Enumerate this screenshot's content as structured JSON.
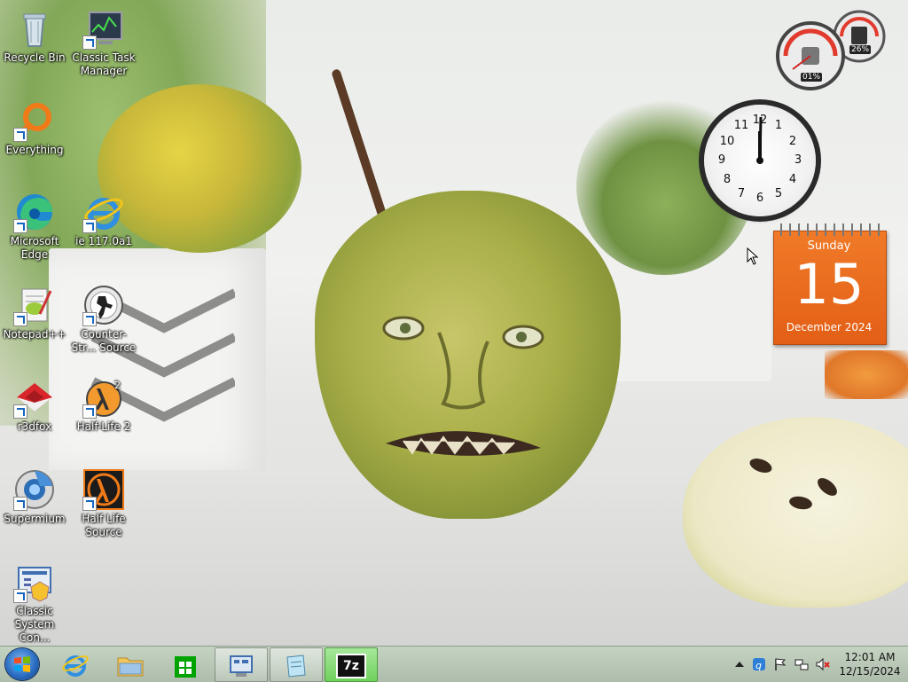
{
  "desktop": {
    "icons": [
      {
        "label": "Recycle Bin",
        "icon": "recycle-bin-icon"
      },
      {
        "label": "Classic Task Manager",
        "icon": "task-manager-icon"
      },
      {
        "label": "Everything",
        "icon": "everything-search-icon"
      },
      {
        "label": "Microsoft Edge",
        "icon": "edge-icon"
      },
      {
        "label": "ie 117.0a1",
        "icon": "internet-explorer-icon"
      },
      {
        "label": "Notepad++",
        "icon": "notepadpp-icon"
      },
      {
        "label": "Counter-Strike: Source",
        "icon": "counter-strike-icon"
      },
      {
        "label": "r3dfox",
        "icon": "r3dfox-icon"
      },
      {
        "label": "Half-Life 2",
        "icon": "half-life-2-icon"
      },
      {
        "label": "Supermium",
        "icon": "supermium-icon"
      },
      {
        "label": "Half Life Source",
        "icon": "half-life-source-icon"
      },
      {
        "label": "Classic System Control",
        "icon": "control-panel-icon"
      }
    ],
    "display_labels": {
      "recycle": "Recycle Bin",
      "taskmgr": "Classic Task Manager",
      "everything": "Everything",
      "edge": "Microsoft Edge",
      "ie": "ie 117.0a1",
      "notepad": "Notepad++",
      "cs": "Counter-Str... Source",
      "r3dfox": "r3dfox",
      "hl2": "Half-Life 2",
      "supermium": "Supermium",
      "hls": "Half Life Source",
      "classic_sys": "Classic System Con..."
    }
  },
  "gadgets": {
    "cpu_meter": {
      "cpu": "01%",
      "memory": "26%"
    },
    "clock": {
      "numbers": [
        "12",
        "1",
        "2",
        "3",
        "4",
        "5",
        "6",
        "7",
        "8",
        "9",
        "10",
        "11"
      ],
      "time_shown": "12:01"
    },
    "calendar": {
      "weekday": "Sunday",
      "day": "15",
      "month_year": "December 2024",
      "accent": "#e8661c"
    }
  },
  "taskbar": {
    "pinned": [
      "start-orb",
      "internet-explorer",
      "file-explorer",
      "microsoft-store",
      "system-settings",
      "notepad",
      "7-zip"
    ],
    "sevenzip_label": "7z",
    "tray": {
      "icons": [
        "show-hidden-chevron",
        "qbittorrent-icon",
        "action-center-flag-icon",
        "network-icon",
        "volume-muted-icon"
      ]
    },
    "clock": {
      "time": "12:01 AM",
      "date": "12/15/2024"
    }
  }
}
